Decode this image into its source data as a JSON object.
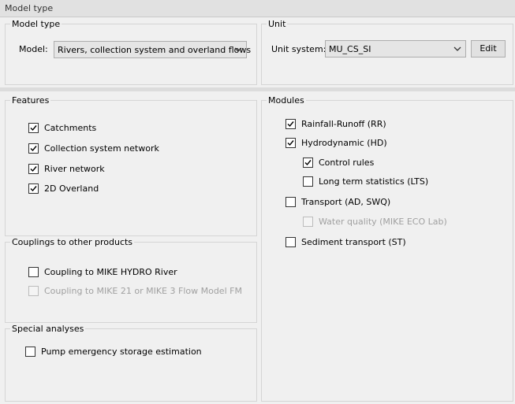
{
  "window": {
    "title": "Model type"
  },
  "model_type_group": {
    "legend": "Model type",
    "model_label": "Model:",
    "model_value": "Rivers, collection system and overland flows"
  },
  "unit_group": {
    "legend": "Unit",
    "unit_label": "Unit system:",
    "unit_value": "MU_CS_SI",
    "edit_label": "Edit"
  },
  "features": {
    "legend": "Features",
    "items": [
      {
        "label": "Catchments",
        "checked": true
      },
      {
        "label": "Collection system network",
        "checked": true
      },
      {
        "label": "River network",
        "checked": true
      },
      {
        "label": "2D Overland",
        "checked": true
      }
    ]
  },
  "couplings": {
    "legend": "Couplings to other products",
    "items": [
      {
        "label": "Coupling to MIKE HYDRO River",
        "checked": false,
        "enabled": true
      },
      {
        "label": "Coupling to MIKE 21 or MIKE 3 Flow Model FM",
        "checked": false,
        "enabled": false
      }
    ]
  },
  "special_analyses": {
    "legend": "Special analyses",
    "items": [
      {
        "label": "Pump emergency storage estimation",
        "checked": false
      }
    ]
  },
  "modules": {
    "legend": "Modules",
    "items": [
      {
        "label": "Rainfall-Runoff (RR)",
        "checked": true,
        "enabled": true
      },
      {
        "label": "Hydrodynamic (HD)",
        "checked": true,
        "enabled": true
      },
      {
        "label": "Control rules",
        "checked": true,
        "enabled": true
      },
      {
        "label": "Long term statistics (LTS)",
        "checked": false,
        "enabled": true
      },
      {
        "label": "Transport (AD, SWQ)",
        "checked": false,
        "enabled": true
      },
      {
        "label": "Water quality (MIKE ECO Lab)",
        "checked": false,
        "enabled": false
      },
      {
        "label": "Sediment transport (ST)",
        "checked": false,
        "enabled": true
      }
    ]
  },
  "icons": {
    "dropdown": "chevron-down-icon",
    "check": "checkmark-icon"
  },
  "colors": {
    "background": "#f0f0f0",
    "group_border": "#d5d5d5",
    "disabled_text": "#a0a0a0"
  }
}
